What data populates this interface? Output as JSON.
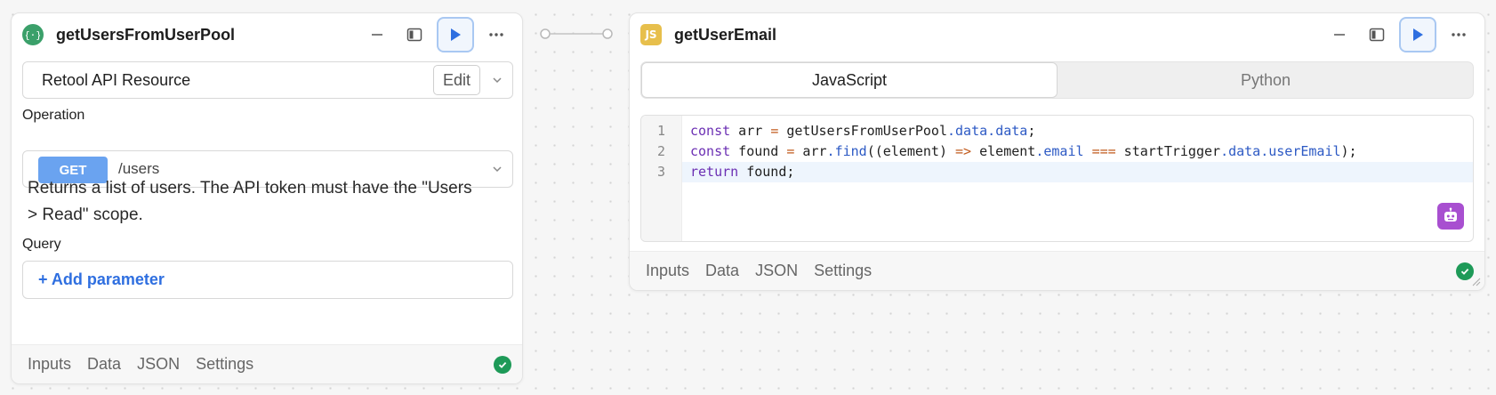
{
  "block1": {
    "title": "getUsersFromUserPool",
    "logo_icon": "api-braces-icon",
    "resource": {
      "name": "Retool API Resource",
      "edit_label": "Edit"
    },
    "operation_label": "Operation",
    "method": "GET",
    "path": "/users",
    "description": "Returns a list of users. The API token must have the \"Users > Read\" scope.",
    "query_label": "Query",
    "add_param_label": "+ Add parameter",
    "footer_tabs": [
      "Inputs",
      "Data",
      "JSON",
      "Settings"
    ]
  },
  "block2": {
    "title": "getUserEmail",
    "logo_text": "JS",
    "lang_tabs": [
      "JavaScript",
      "Python"
    ],
    "line_numbers": [
      "1",
      "2",
      "3"
    ],
    "code_lines": [
      "const arr = getUsersFromUserPool.data.data;",
      "const found = arr.find((element) => element.email === startTrigger.data.userEmail);",
      "return found;"
    ],
    "footer_tabs": [
      "Inputs",
      "Data",
      "JSON",
      "Settings"
    ]
  },
  "colors": {
    "accent": "#2f6fe0",
    "method_get": "#6aa3f0",
    "success": "#1e9a58",
    "js_logo": "#e7bf4c",
    "api_logo": "#3ba06a",
    "ai_assist": "#a84fd0"
  }
}
